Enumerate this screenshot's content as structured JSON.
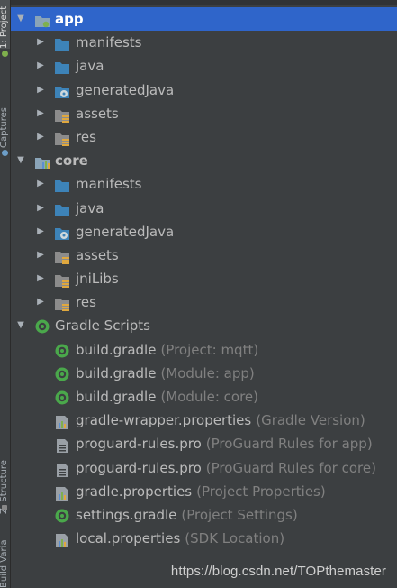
{
  "sidebar": {
    "project_tab": "1: Project",
    "captures_tab": "Captures",
    "structure_tab": "Z: Structure",
    "variants_tab": "Build Variants"
  },
  "tree": {
    "app": {
      "label": "app",
      "children": [
        "manifests",
        "java",
        "generatedJava",
        "assets",
        "res"
      ]
    },
    "core": {
      "label": "core",
      "children": [
        "manifests",
        "java",
        "generatedJava",
        "assets",
        "jniLibs",
        "res"
      ]
    },
    "gradle_scripts": {
      "label": "Gradle Scripts",
      "files": [
        {
          "name": "build.gradle",
          "hint": "(Project: mqtt)"
        },
        {
          "name": "build.gradle",
          "hint": "(Module: app)"
        },
        {
          "name": "build.gradle",
          "hint": "(Module: core)"
        },
        {
          "name": "gradle-wrapper.properties",
          "hint": "(Gradle Version)"
        },
        {
          "name": "proguard-rules.pro",
          "hint": "(ProGuard Rules for app)"
        },
        {
          "name": "proguard-rules.pro",
          "hint": "(ProGuard Rules for core)"
        },
        {
          "name": "gradle.properties",
          "hint": "(Project Properties)"
        },
        {
          "name": "settings.gradle",
          "hint": "(Project Settings)"
        },
        {
          "name": "local.properties",
          "hint": "(SDK Location)"
        }
      ]
    }
  },
  "watermark": "https://blog.csdn.net/TOPthemaster",
  "colors": {
    "background": "#3c3f41",
    "selection": "#2f65ca",
    "folder_blue": "#3d83b8",
    "text": "#bbbbbb",
    "hint_text": "#808080",
    "gradle_green": "#4aa84b"
  }
}
